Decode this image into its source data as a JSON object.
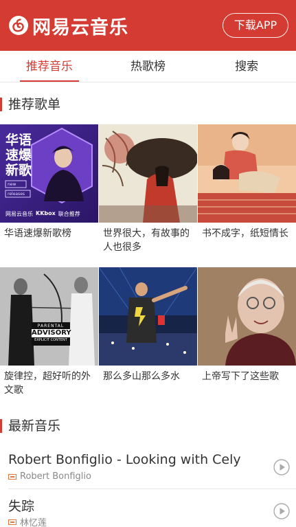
{
  "app": {
    "logo_text": "网易云音乐",
    "download_label": "下载APP"
  },
  "tabs": [
    {
      "label": "推荐音乐",
      "active": true
    },
    {
      "label": "热歌榜",
      "active": false
    },
    {
      "label": "搜索",
      "active": false
    }
  ],
  "sections": {
    "recommend_title": "推荐歌单",
    "newest_title": "最新音乐"
  },
  "playlists": [
    {
      "name": "华语速爆新歌榜",
      "cover": {
        "title_line1": "华语",
        "title_line2": "速爆",
        "title_line3": "新歌",
        "tag1": "new",
        "tag2": "releases",
        "brand": "网易云音乐",
        "partner": "KKbox",
        "partner_tag": "联合推荐"
      }
    },
    {
      "name": "世界很大，有故事的人也很多"
    },
    {
      "name": "书不成字，纸短情长"
    },
    {
      "name": "旋律控，超好听的外文歌",
      "cover": {
        "advisory_line1": "PARENTAL",
        "advisory_line2": "ADVISORY",
        "advisory_line3": "EXPLICIT CONTENT"
      }
    },
    {
      "name": "那么多山那么多水"
    },
    {
      "name": "上帝写下了这些歌"
    }
  ],
  "songs": [
    {
      "title": "Robert Bonfiglio - Looking with Cely",
      "artist": "Robert Bonfiglio"
    },
    {
      "title": "失踪",
      "artist": "林忆莲"
    }
  ],
  "colors": {
    "brand_red": "#d43c33",
    "sq_orange": "#e7733a"
  }
}
